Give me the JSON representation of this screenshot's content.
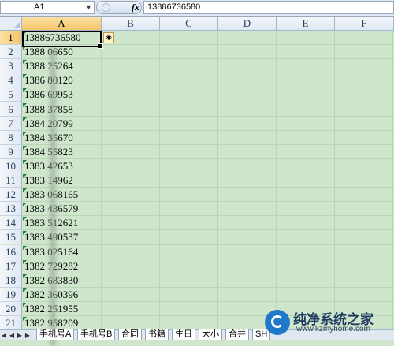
{
  "formula_bar": {
    "name_box": "A1",
    "fx_label": "fx",
    "formula_value": "13886736580"
  },
  "columns": [
    "A",
    "B",
    "C",
    "D",
    "E",
    "F"
  ],
  "rows": [
    "1",
    "2",
    "3",
    "4",
    "5",
    "6",
    "7",
    "8",
    "9",
    "10",
    "11",
    "12",
    "13",
    "14",
    "15",
    "16",
    "17",
    "18",
    "19",
    "20",
    "21"
  ],
  "cells": [
    "13886736580",
    "1388  06650",
    "1388  25264",
    "1386  80120",
    "1386  69953",
    "1388  37858",
    "1384  20799",
    "1384  35670",
    "1384  55823",
    "1383  42653",
    "1383  14962",
    "1383  068165",
    "1383  436579",
    "1383  512621",
    "1383  490537",
    "1383  025164",
    "1382  729282",
    "1382  683830",
    "1382  360396",
    "1382  251955",
    "1382  958209"
  ],
  "sheet_tabs": [
    "手机号A",
    "手机号B",
    "合同",
    "书籍",
    "生日",
    "大小",
    "合并",
    "SH"
  ],
  "watermark": {
    "text": "纯净系统之家",
    "url": "www.kzmyhome.com"
  },
  "colors": {
    "cell_background": "#cfe6cc",
    "header_selected": "#f4c56a",
    "text_marker": "#1e7d33"
  }
}
